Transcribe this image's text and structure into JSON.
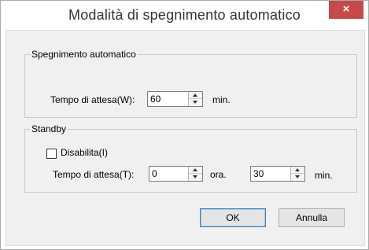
{
  "window": {
    "title": "Modalità di spegnimento automatico",
    "close_glyph": "×"
  },
  "auto_shutdown": {
    "group_label": "Spegnimento automatico",
    "wait_label": "Tempo di attesa(W):",
    "wait_value": "60",
    "unit": "min."
  },
  "standby": {
    "group_label": "Standby",
    "disable_label": "Disabilita(I)",
    "disable_checked": false,
    "wait_label": "Tempo di attesa(T):",
    "hours_value": "0",
    "hours_unit": "ora.",
    "minutes_value": "30",
    "minutes_unit": "min."
  },
  "buttons": {
    "ok_label": "OK",
    "cancel_label": "Annulla"
  },
  "colors": {
    "close_button": "#c74a4a",
    "default_button_border": "#3c7fb1"
  }
}
